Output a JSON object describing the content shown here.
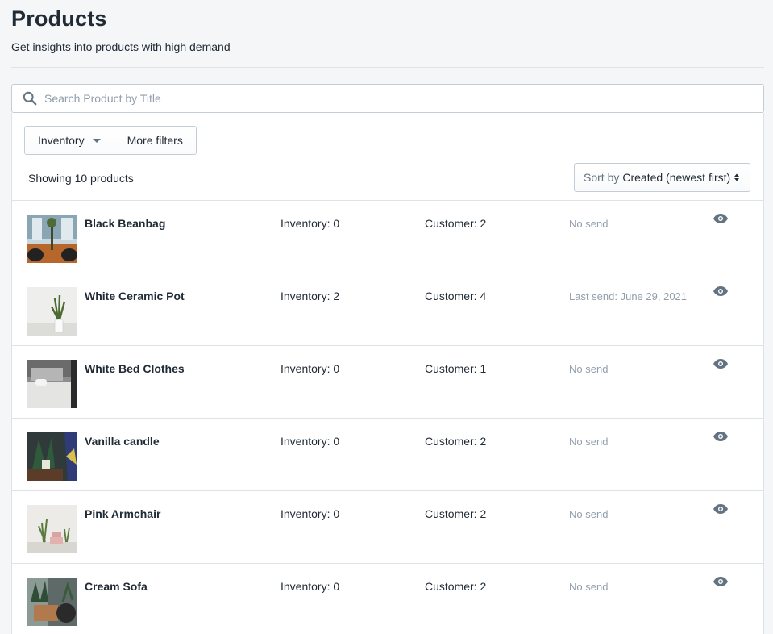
{
  "header": {
    "title": "Products",
    "subtitle": "Get insights into products with high demand"
  },
  "search": {
    "placeholder": "Search Product by Title",
    "value": "",
    "icon": "search-icon"
  },
  "filters": {
    "inventory_label": "Inventory",
    "more_filters_label": "More filters"
  },
  "summary": {
    "showing_text": "Showing 10 products"
  },
  "sort": {
    "label": "Sort by",
    "value": "Created (newest first)"
  },
  "products": [
    {
      "name": "Black Beanbag",
      "inventory": "Inventory: 0",
      "customer": "Customer: 2",
      "send": "No send"
    },
    {
      "name": "White Ceramic Pot",
      "inventory": "Inventory: 2",
      "customer": "Customer: 4",
      "send": "Last send: June 29, 2021"
    },
    {
      "name": "White Bed Clothes",
      "inventory": "Inventory: 0",
      "customer": "Customer: 1",
      "send": "No send"
    },
    {
      "name": "Vanilla candle",
      "inventory": "Inventory: 0",
      "customer": "Customer: 2",
      "send": "No send"
    },
    {
      "name": "Pink Armchair",
      "inventory": "Inventory: 0",
      "customer": "Customer: 2",
      "send": "No send"
    },
    {
      "name": "Cream Sofa",
      "inventory": "Inventory: 0",
      "customer": "Customer: 2",
      "send": "No send"
    }
  ],
  "colors": {
    "text": "#212b36",
    "muted": "#919eab",
    "border": "#dfe3e8",
    "background": "#f4f6f8",
    "icon": "#637381"
  }
}
